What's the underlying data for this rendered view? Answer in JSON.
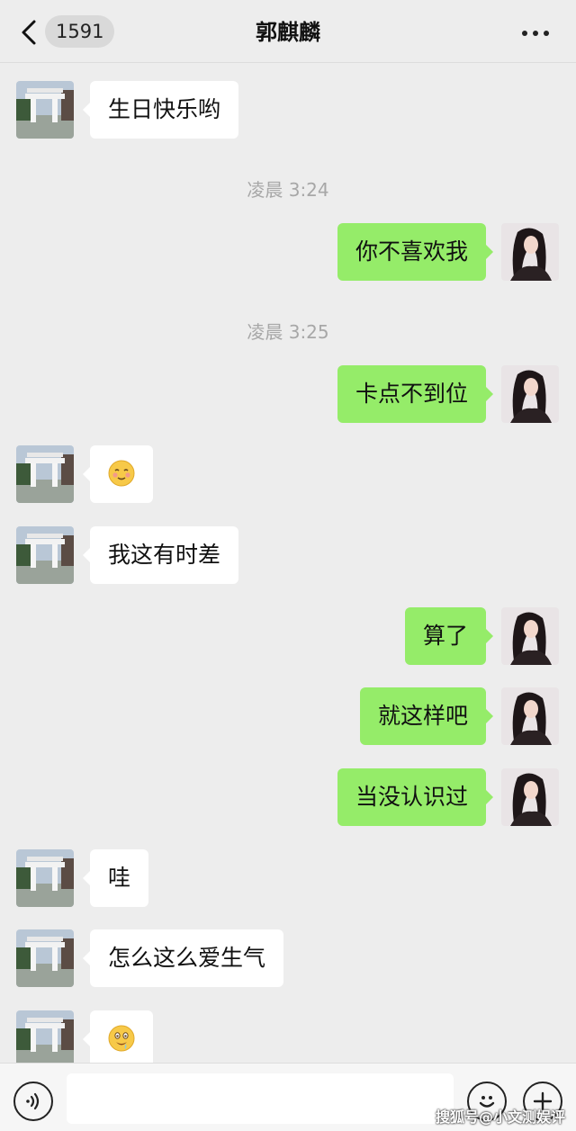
{
  "header": {
    "back_icon": "chevron-left-icon",
    "unread_count": "1591",
    "title": "郭麒麟",
    "more_icon": "ellipsis-icon"
  },
  "messages": [
    {
      "side": "in",
      "text": "生日快乐哟"
    },
    {
      "type": "time",
      "text": "凌晨 3:24"
    },
    {
      "side": "out",
      "text": "你不喜欢我"
    },
    {
      "type": "time",
      "text": "凌晨 3:25"
    },
    {
      "side": "out",
      "text": "卡点不到位"
    },
    {
      "side": "in",
      "emoji": "smiling-blush-emoji"
    },
    {
      "side": "in",
      "text": "我这有时差"
    },
    {
      "side": "out",
      "text": "算了"
    },
    {
      "side": "out",
      "text": "就这样吧"
    },
    {
      "side": "out",
      "text": "当没认识过"
    },
    {
      "side": "in",
      "text": "哇"
    },
    {
      "side": "in",
      "text": "怎么这么爱生气"
    },
    {
      "side": "in",
      "emoji": "drooling-emoji"
    }
  ],
  "input_bar": {
    "voice_icon": "voice-icon",
    "input_placeholder": "",
    "emoji_icon": "emoji-icon",
    "plus_icon": "plus-icon"
  },
  "watermark": "搜狐号@小文测娱评",
  "colors": {
    "background": "#ededed",
    "outgoing_bubble": "#95ec69",
    "incoming_bubble": "#ffffff",
    "timestamp": "#a7a7a7"
  }
}
